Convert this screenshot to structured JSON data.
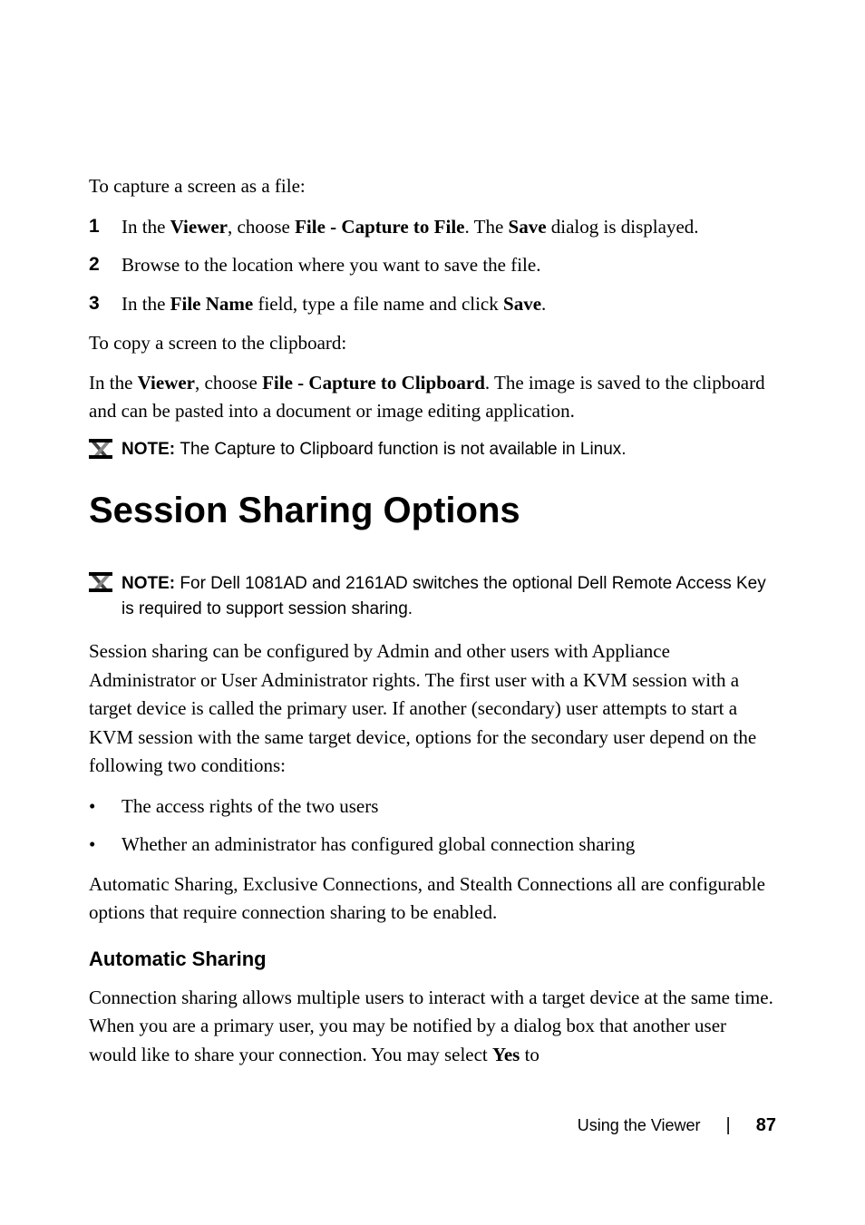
{
  "intro": "To capture a screen as a file:",
  "steps": [
    {
      "num": "1",
      "pre": "In the ",
      "b1": "Viewer",
      "mid1": ", choose ",
      "b2": "File - Capture to File",
      "mid2": ". The ",
      "b3": "Save",
      "post": " dialog is displayed."
    },
    {
      "num": "2",
      "full": "Browse to the location where you want to save the file."
    },
    {
      "num": "3",
      "pre": "In the ",
      "b1": "File Name",
      "mid1": " field, type a file name and click ",
      "b2": "Save",
      "post": "."
    }
  ],
  "copyIntro": "To copy a screen to the clipboard:",
  "copyPara": {
    "pre": "In the ",
    "b1": "Viewer",
    "mid1": ", choose ",
    "b2": "File - Capture to Clipboard",
    "post": ". The image is saved to the clipboard and can be pasted into a document or image editing application."
  },
  "note1": {
    "label": "NOTE: ",
    "text": "The Capture to Clipboard function is not available in Linux."
  },
  "h1": "Session Sharing Options",
  "note2": {
    "label": "NOTE: ",
    "text": "For Dell 1081AD and 2161AD switches the optional Dell Remote Access Key is required to support session sharing."
  },
  "sessionPara": "Session sharing can be configured by Admin and other users with Appliance Administrator or User Administrator rights. The first user with a KVM session with a target device is called the primary user. If another (secondary) user attempts to start a KVM session with the same target device, options for the secondary user depend on the following two conditions:",
  "bullets": [
    "The access rights of the two users",
    "Whether an administrator has configured global connection sharing"
  ],
  "autoPara": "Automatic Sharing, Exclusive Connections, and Stealth Connections all are configurable options that require connection sharing to be enabled.",
  "h3": "Automatic Sharing",
  "autoSharingPara": {
    "pre": "Connection sharing allows multiple users to interact with a target device at the same time. When you are a primary user, you may be notified by a dialog box that another user would like to share your connection. You may select ",
    "b1": "Yes",
    "post": " to"
  },
  "footer": {
    "title": "Using the Viewer",
    "page": "87"
  }
}
